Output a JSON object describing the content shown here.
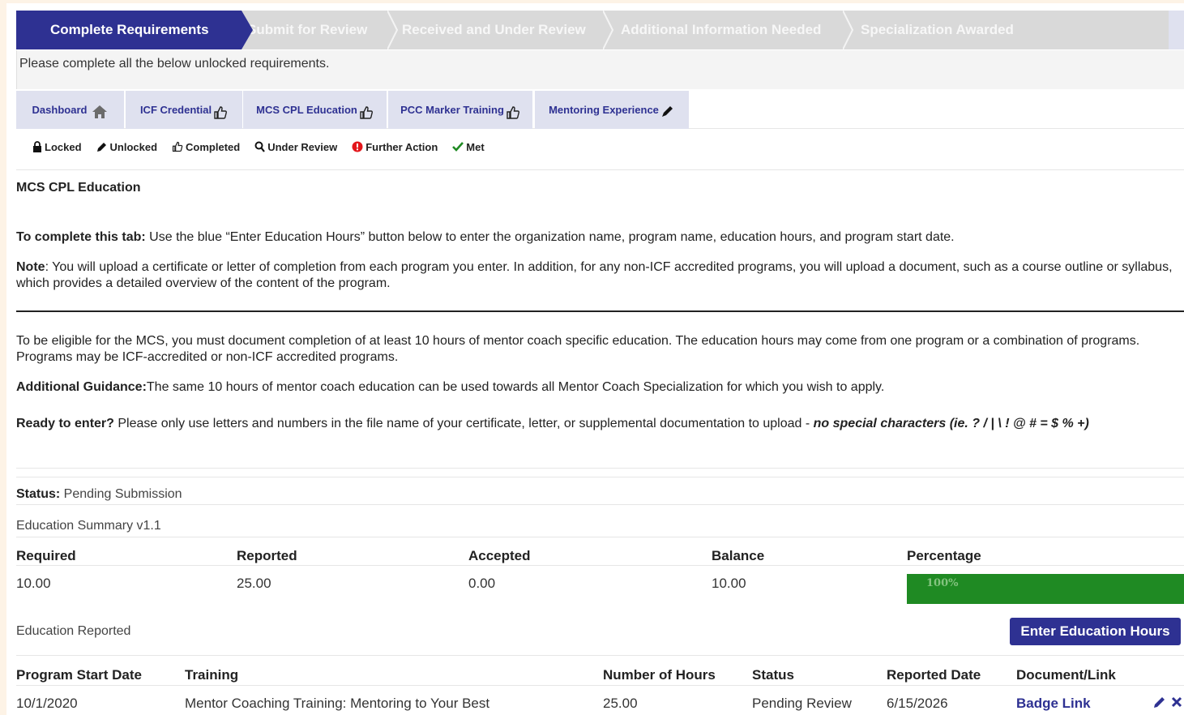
{
  "steps": [
    {
      "label": "Complete Requirements",
      "state": "active"
    },
    {
      "label": "Submit for Review",
      "state": "inactive"
    },
    {
      "label": "Received and Under Review",
      "state": "inactive"
    },
    {
      "label": "Additional Information Needed",
      "state": "inactive"
    },
    {
      "label": "Specialization Awarded",
      "state": "inactive"
    }
  ],
  "instruction": "Please complete all the below unlocked requirements.",
  "tabs": [
    {
      "label": "Dashboard",
      "icon": "home-icon"
    },
    {
      "label": "ICF Credential",
      "icon": "thumbs-up-icon"
    },
    {
      "label": "MCS CPL Education",
      "icon": "thumbs-up-icon"
    },
    {
      "label": "PCC Marker Training",
      "icon": "thumbs-up-icon"
    },
    {
      "label": "Mentoring Experience",
      "icon": "pencil-icon"
    }
  ],
  "legend": {
    "locked": "Locked",
    "unlocked": "Unlocked",
    "completed": "Completed",
    "under_review": "Under Review",
    "further_action": "Further Action",
    "met": "Met"
  },
  "section_title": "MCS CPL Education",
  "complete_tab": {
    "label": "To complete this tab:",
    "text": " Use the blue “Enter Education Hours” button below to enter the organization name, program name, education hours, and program start date."
  },
  "note": {
    "label": "Note",
    "text": ": You will upload a certificate or letter of completion from each program you enter. In addition, for any non-ICF accredited programs, you will upload a document, such as a course outline or syllabus, which provides a detailed overview of the content of the program."
  },
  "eligibility": "To be eligible for the MCS, you must document completion of at least 10 hours of mentor coach specific education. The education hours may come from one program or a combination of programs.  Programs may be ICF-accredited or non-ICF accredited programs.",
  "guidance": {
    "label": "Additional Guidance:",
    "text": "The same 10 hours of mentor coach education can be used towards all Mentor Coach Specialization for which you wish to apply."
  },
  "ready": {
    "label": "Ready to enter?",
    "text": " Please only use letters and numbers in the file name of your certificate, letter, or supplemental documentation to upload - ",
    "emphasis": "no special characters (ie. ? / | \\ ! @ # = $ % +)"
  },
  "status": {
    "label": "Status:",
    "value": " Pending Submission"
  },
  "summary": {
    "title": "Education Summary v1.1",
    "headers": [
      "Required",
      "Reported",
      "Accepted",
      "Balance",
      "Percentage"
    ],
    "values": [
      "10.00",
      "25.00",
      "0.00",
      "10.00"
    ],
    "percentage": 100,
    "percentage_label": "100%"
  },
  "reported": {
    "title": "Education Reported",
    "button": "Enter Education Hours",
    "headers": [
      "Program Start Date",
      "Training",
      "Number of Hours",
      "Status",
      "Reported Date",
      "Document/Link"
    ],
    "rows": [
      [
        "10/1/2020",
        "Mentor Coaching Training: Mentoring to Your Best",
        "25.00",
        "Pending Review",
        "6/15/2026",
        "Badge Link"
      ]
    ]
  },
  "colors": {
    "brand": "#2e3192",
    "success": "#1f8a23",
    "tab_bg": "#dfe1ef"
  }
}
